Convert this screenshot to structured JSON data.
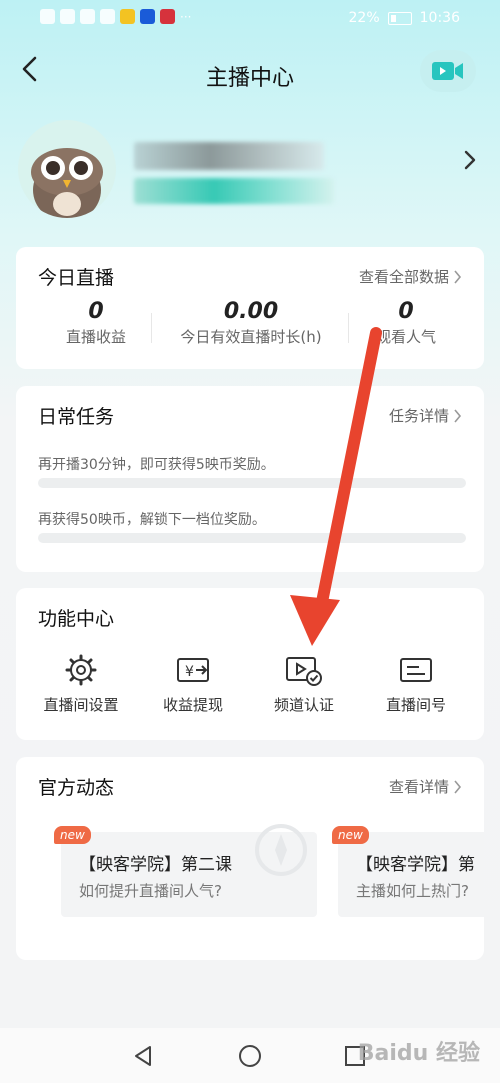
{
  "status_bar": {
    "battery": "22%",
    "time": "10:36"
  },
  "header": {
    "title": "主播中心",
    "back_icon": "back-arrow-icon",
    "video_icon": "video-camera-icon",
    "accent": "#27c5bf"
  },
  "today_live": {
    "title": "今日直播",
    "link": "查看全部数据",
    "stats": [
      {
        "value": "0",
        "label": "直播收益"
      },
      {
        "value": "0.00",
        "label": "今日有效直播时长(h)"
      },
      {
        "value": "0",
        "label": "观看人气"
      }
    ]
  },
  "daily_tasks": {
    "title": "日常任务",
    "link": "任务详情",
    "tasks": [
      {
        "text": "再开播30分钟，即可获得5映币奖励。",
        "progress": 0
      },
      {
        "text": "再获得50映币，解锁下一档位奖励。",
        "progress": 0
      }
    ]
  },
  "functions": {
    "title": "功能中心",
    "items": [
      {
        "label": "直播间设置",
        "icon": "gear-icon"
      },
      {
        "label": "收益提现",
        "icon": "withdraw-icon"
      },
      {
        "label": "频道认证",
        "icon": "channel-verify-icon"
      },
      {
        "label": "直播间号",
        "icon": "room-id-icon"
      }
    ]
  },
  "news": {
    "title": "官方动态",
    "link": "查看详情",
    "items": [
      {
        "tag": "new",
        "title": "【映客学院】第二课",
        "subtitle": "如何提升直播间人气?"
      },
      {
        "tag": "new",
        "title": "【映客学院】第",
        "subtitle": "主播如何上热门?"
      }
    ]
  },
  "annotation": {
    "arrow_color": "#e8442e"
  },
  "watermark": {
    "text": "Baidu 经验"
  }
}
